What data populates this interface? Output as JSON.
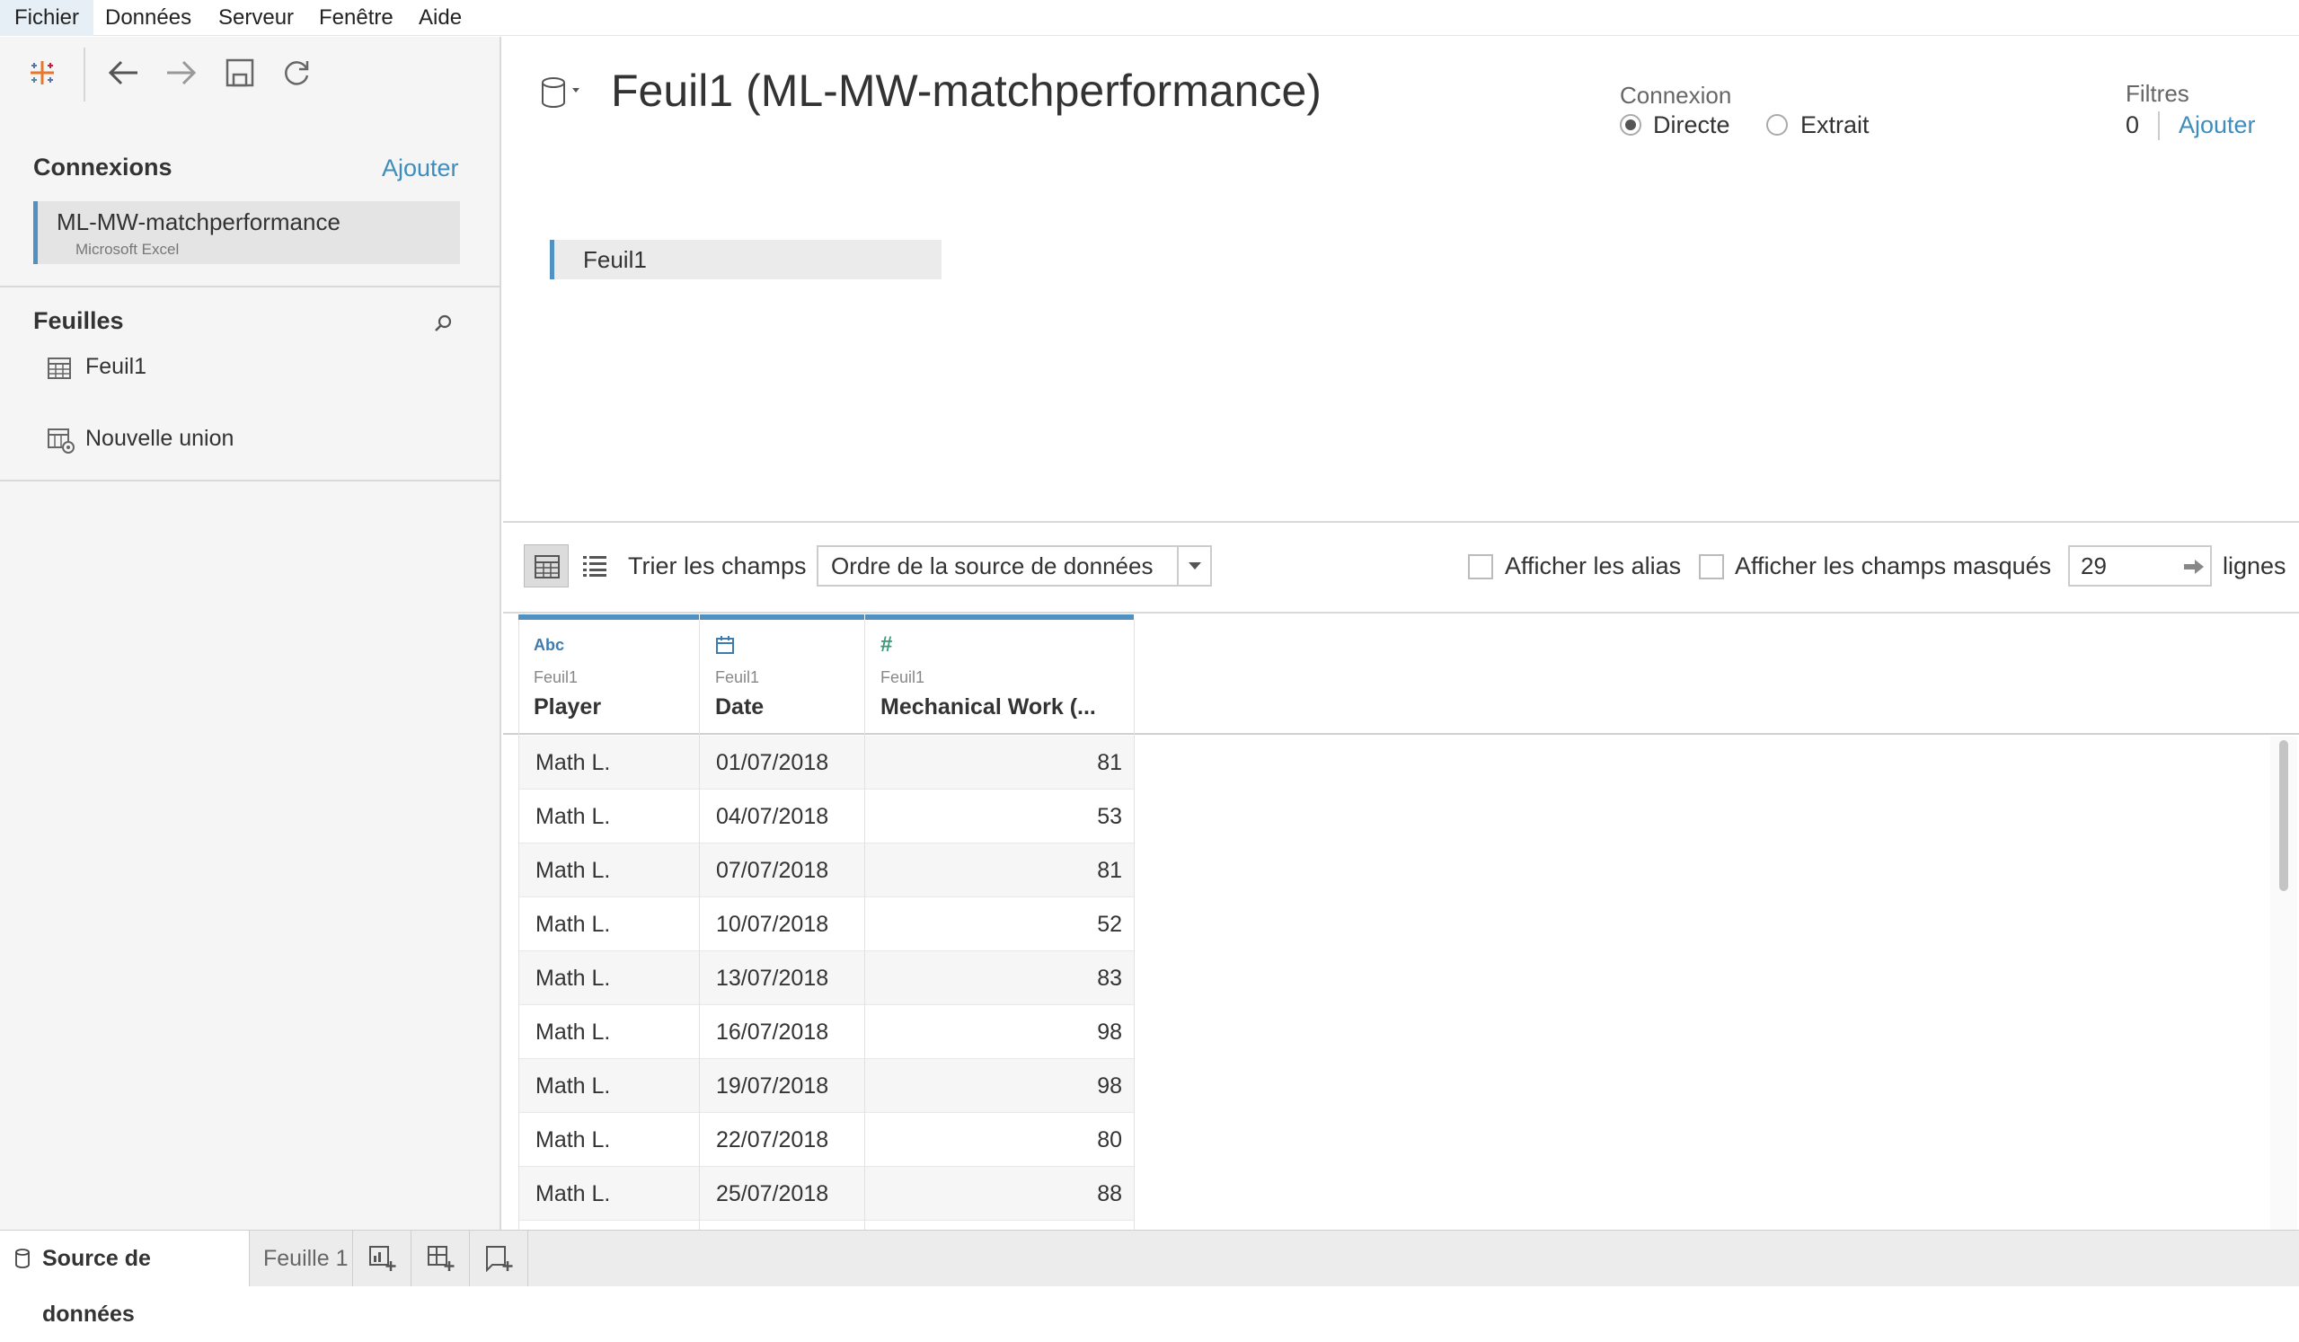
{
  "menu": {
    "items": [
      "Fichier",
      "Données",
      "Serveur",
      "Fenêtre",
      "Aide"
    ]
  },
  "sidebar": {
    "connections_title": "Connexions",
    "connections_add": "Ajouter",
    "connection": {
      "name": "ML-MW-matchperformance",
      "type": "Microsoft Excel"
    },
    "sheets_title": "Feuilles",
    "sheets": [
      "Feuil1"
    ],
    "new_union": "Nouvelle union"
  },
  "header": {
    "title": "Feuil1 (ML-MW-matchperformance)",
    "connection_label": "Connexion",
    "connection_options": [
      "Directe",
      "Extrait"
    ],
    "connection_selected": "Directe",
    "filters_label": "Filtres",
    "filters_count": "0",
    "filters_add": "Ajouter"
  },
  "canvas": {
    "table_pill": "Feuil1"
  },
  "grid_toolbar": {
    "sort_label": "Trier les champs",
    "sort_value": "Ordre de la source de données",
    "show_aliases": "Afficher les alias",
    "show_hidden": "Afficher les champs masqués",
    "rows_value": "29",
    "rows_label": "lignes"
  },
  "grid": {
    "columns": [
      {
        "type_icon": "Abc",
        "source": "Feuil1",
        "name": "Player"
      },
      {
        "type_icon": "calendar-icon",
        "source": "Feuil1",
        "name": "Date"
      },
      {
        "type_icon": "#",
        "source": "Feuil1",
        "name": "Mechanical Work (..."
      }
    ],
    "rows": [
      [
        "Math L.",
        "01/07/2018",
        "81"
      ],
      [
        "Math L.",
        "04/07/2018",
        "53"
      ],
      [
        "Math L.",
        "07/07/2018",
        "81"
      ],
      [
        "Math L.",
        "10/07/2018",
        "52"
      ],
      [
        "Math L.",
        "13/07/2018",
        "83"
      ],
      [
        "Math L.",
        "16/07/2018",
        "98"
      ],
      [
        "Math L.",
        "19/07/2018",
        "98"
      ],
      [
        "Math L.",
        "22/07/2018",
        "80"
      ],
      [
        "Math L.",
        "25/07/2018",
        "88"
      ]
    ]
  },
  "tabs": {
    "data_source": "Source de données",
    "sheet1": "Feuille 1"
  },
  "colors": {
    "accent": "#4f91c3",
    "link": "#3e8dbd",
    "measure_green": "#3a9a7a"
  }
}
